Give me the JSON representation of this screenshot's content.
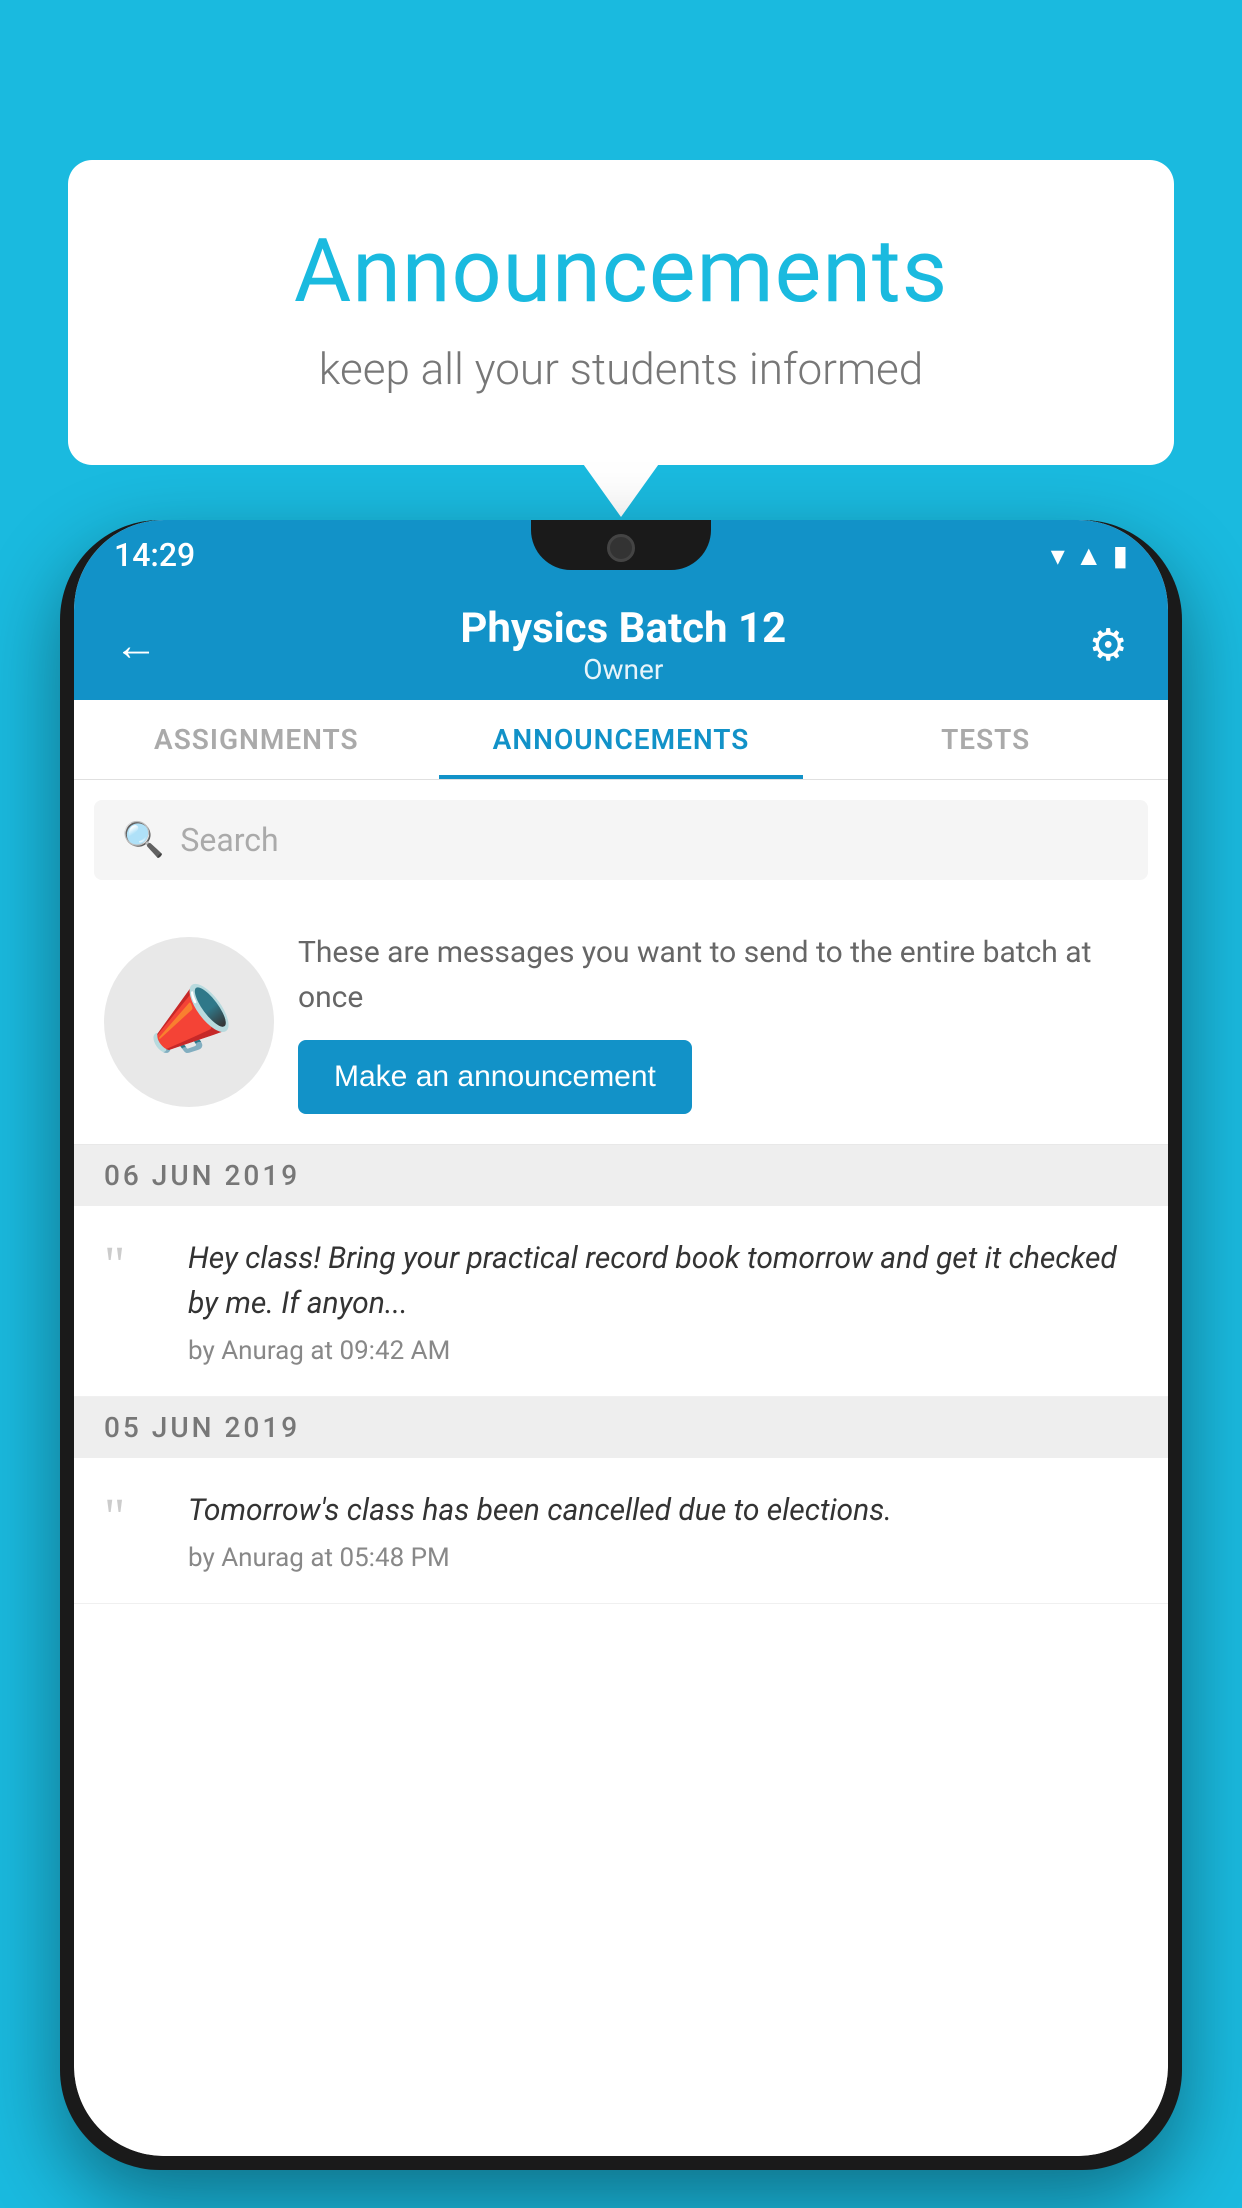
{
  "background_color": "#1ABADF",
  "speech_bubble": {
    "title": "Announcements",
    "subtitle": "keep all your students informed"
  },
  "phone": {
    "status_bar": {
      "time": "14:29",
      "icons": [
        "wifi",
        "signal",
        "battery"
      ]
    },
    "app_bar": {
      "back_label": "←",
      "title": "Physics Batch 12",
      "subtitle": "Owner",
      "settings_label": "⚙"
    },
    "tabs": [
      {
        "label": "ASSIGNMENTS",
        "active": false
      },
      {
        "label": "ANNOUNCEMENTS",
        "active": true
      },
      {
        "label": "TESTS",
        "active": false
      }
    ],
    "search": {
      "placeholder": "Search"
    },
    "announcement_promo": {
      "description": "These are messages you want to send to the entire batch at once",
      "button_label": "Make an announcement"
    },
    "announcements": [
      {
        "date_label": "06  JUN  2019",
        "text": "Hey class! Bring your practical record book tomorrow and get it checked by me. If anyon...",
        "meta": "by Anurag at 09:42 AM"
      },
      {
        "date_label": "05  JUN  2019",
        "text": "Tomorrow's class has been cancelled due to elections.",
        "meta": "by Anurag at 05:48 PM"
      }
    ]
  }
}
